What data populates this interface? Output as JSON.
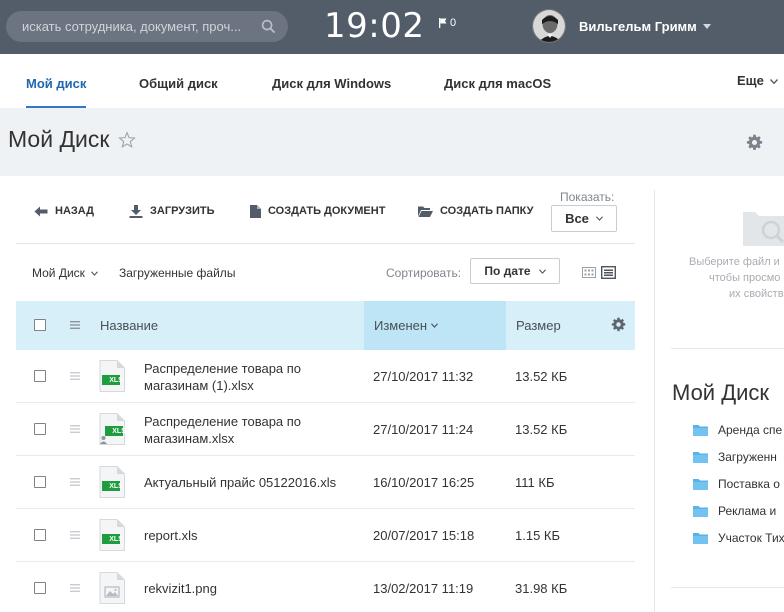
{
  "header": {
    "search_placeholder": "искать сотрудника, документ, проч...",
    "time": "19:02",
    "flag_count": "0",
    "user_name": "Вильгельм Гримм"
  },
  "tabs": [
    {
      "label": "Мой диск",
      "active": true
    },
    {
      "label": "Общий диск",
      "active": false
    },
    {
      "label": "Диск для Windows",
      "active": false
    },
    {
      "label": "Диск для macOS",
      "active": false
    }
  ],
  "tabs_more": "Еще",
  "page": {
    "title": "Мой Диск"
  },
  "toolbar": {
    "back": "НАЗАД",
    "upload": "ЗАГРУЗИТЬ",
    "create_doc": "СОЗДАТЬ ДОКУМЕНТ",
    "create_folder": "СОЗДАТЬ ПАПКУ",
    "show_label": "Показать:",
    "show_value": "Все"
  },
  "breadcrumb": {
    "root": "Мой Диск",
    "current": "Загруженные файлы"
  },
  "sort": {
    "label": "Сортировать:",
    "value": "По дате"
  },
  "table": {
    "columns": {
      "name": "Название",
      "modified": "Изменен",
      "size": "Размер"
    },
    "rows": [
      {
        "name_line1": "Распределение товара по",
        "name_line2": "магазинам (1).xlsx",
        "modified": "27/10/2017 11:32",
        "size": "13.52 КБ",
        "type": "xls",
        "badge": "XLS"
      },
      {
        "name_line1": "Распределение товара по",
        "name_line2": "магазинам.xlsx",
        "modified": "27/10/2017 11:24",
        "size": "13.52 КБ",
        "type": "xls-shared",
        "badge": "XLS"
      },
      {
        "name_line1": "Актуальный прайс 05122016.xls",
        "name_line2": "",
        "modified": "16/10/2017 16:25",
        "size": "111 КБ",
        "type": "xls",
        "badge": "XLS"
      },
      {
        "name_line1": "report.xls",
        "name_line2": "",
        "modified": "20/07/2017 15:18",
        "size": "1.15 КБ",
        "type": "xls",
        "badge": "XLS"
      },
      {
        "name_line1": "rekvizit1.png",
        "name_line2": "",
        "modified": "13/02/2017 11:19",
        "size": "31.98 КБ",
        "type": "image",
        "badge": ""
      }
    ]
  },
  "side": {
    "hint_lines": [
      "Выберите файл и",
      "чтобы просмо",
      "их свойств"
    ],
    "title": "Мой Диск",
    "folders": [
      "Аренда спе",
      "Загруженн",
      "Поставка о",
      "Реклама и",
      "Участок Тих"
    ]
  },
  "colors": {
    "topbar": "#535c69",
    "accent": "#2067b0",
    "header_row": "#d6eff9",
    "sorted_col": "#bde5f5",
    "excel_green": "#1f9c3e",
    "folder": "#5ab3e6"
  }
}
